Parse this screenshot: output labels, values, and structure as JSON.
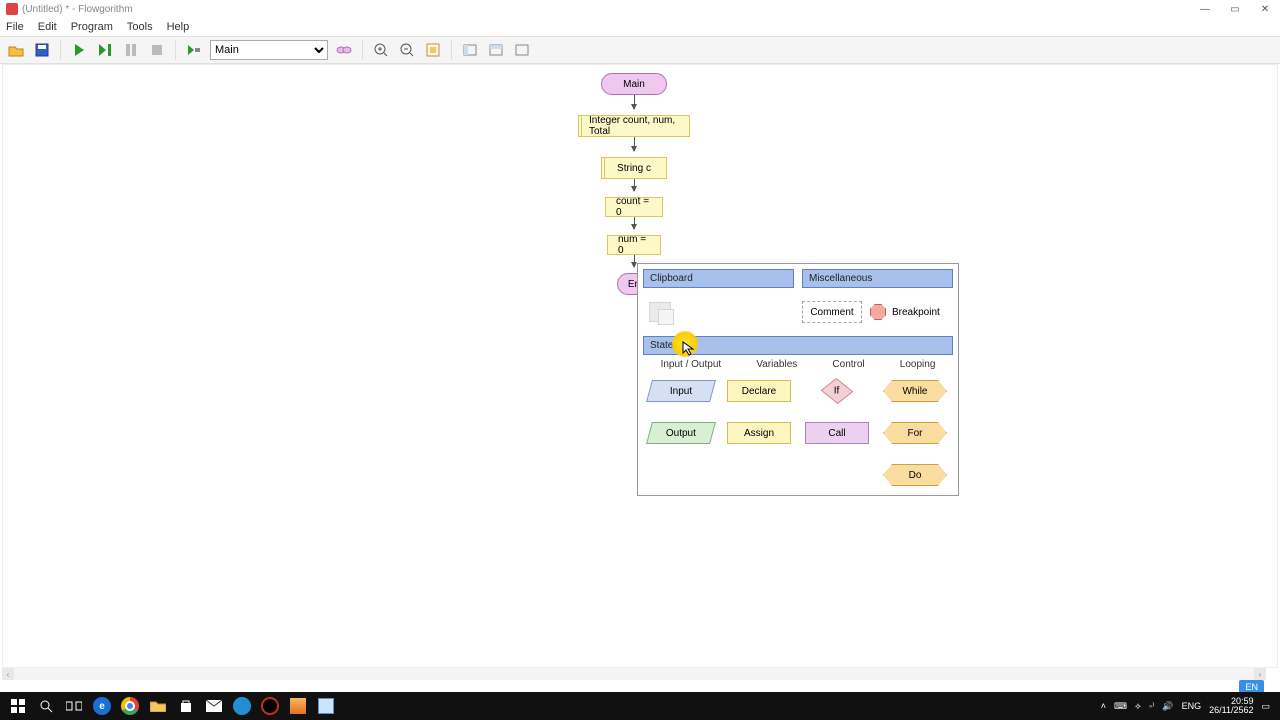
{
  "window": {
    "title": "(Untitled) * - Flowgorithm",
    "min": "—",
    "max": "▭",
    "close": "✕"
  },
  "menu": {
    "file": "File",
    "edit": "Edit",
    "program": "Program",
    "tools": "Tools",
    "help": "Help"
  },
  "toolbar": {
    "function_selected": "Main"
  },
  "flowchart": {
    "main": "Main",
    "declare1": "Integer count, num, Total",
    "declare2": "String c",
    "assign1": "count = 0",
    "assign2": "num = 0",
    "end_partial": "En"
  },
  "popup": {
    "clipboard": "Clipboard",
    "misc": "Miscellaneous",
    "comment": "Comment",
    "breakpoint": "Breakpoint",
    "statement": "Statement",
    "col_io": "Input / Output",
    "col_vars": "Variables",
    "col_ctrl": "Control",
    "col_loop": "Looping",
    "input": "Input",
    "output": "Output",
    "declare": "Declare",
    "assign": "Assign",
    "if": "If",
    "call": "Call",
    "while": "While",
    "for": "For",
    "do": "Do"
  },
  "lang_badge": "EN",
  "tray": {
    "lang": "ENG",
    "time": "20:59",
    "date": "26/11/2562"
  }
}
